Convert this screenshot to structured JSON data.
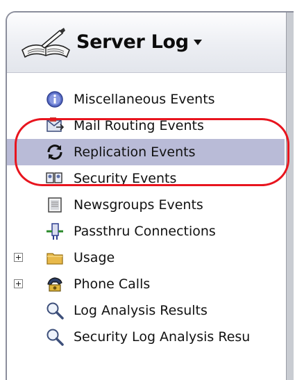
{
  "header": {
    "title": "Server Log",
    "menu_icon": "chevron-down-icon",
    "logo_icon": "log-book-icon"
  },
  "items": [
    {
      "label": "Miscellaneous Events",
      "icon": "info-icon",
      "expandable": false,
      "selected": false
    },
    {
      "label": "Mail Routing Events",
      "icon": "mail-routing-icon",
      "expandable": false,
      "selected": false
    },
    {
      "label": "Replication Events",
      "icon": "replication-icon",
      "expandable": false,
      "selected": true
    },
    {
      "label": "Security Events",
      "icon": "security-users-icon",
      "expandable": false,
      "selected": false
    },
    {
      "label": "Newsgroups Events",
      "icon": "newsgroups-icon",
      "expandable": false,
      "selected": false
    },
    {
      "label": "Passthru Connections",
      "icon": "passthru-icon",
      "expandable": false,
      "selected": false
    },
    {
      "label": "Usage",
      "icon": "folder-icon",
      "expandable": true,
      "selected": false
    },
    {
      "label": "Phone Calls",
      "icon": "phone-calls-icon",
      "expandable": true,
      "selected": false
    },
    {
      "label": "Log Analysis Results",
      "icon": "magnifier-icon",
      "expandable": false,
      "selected": false
    },
    {
      "label": "Security Log Analysis Resu",
      "icon": "magnifier-icon",
      "expandable": false,
      "selected": false
    }
  ],
  "annotation": {
    "color": "#e8141e"
  },
  "colors": {
    "selection": "#b9bbd7"
  }
}
